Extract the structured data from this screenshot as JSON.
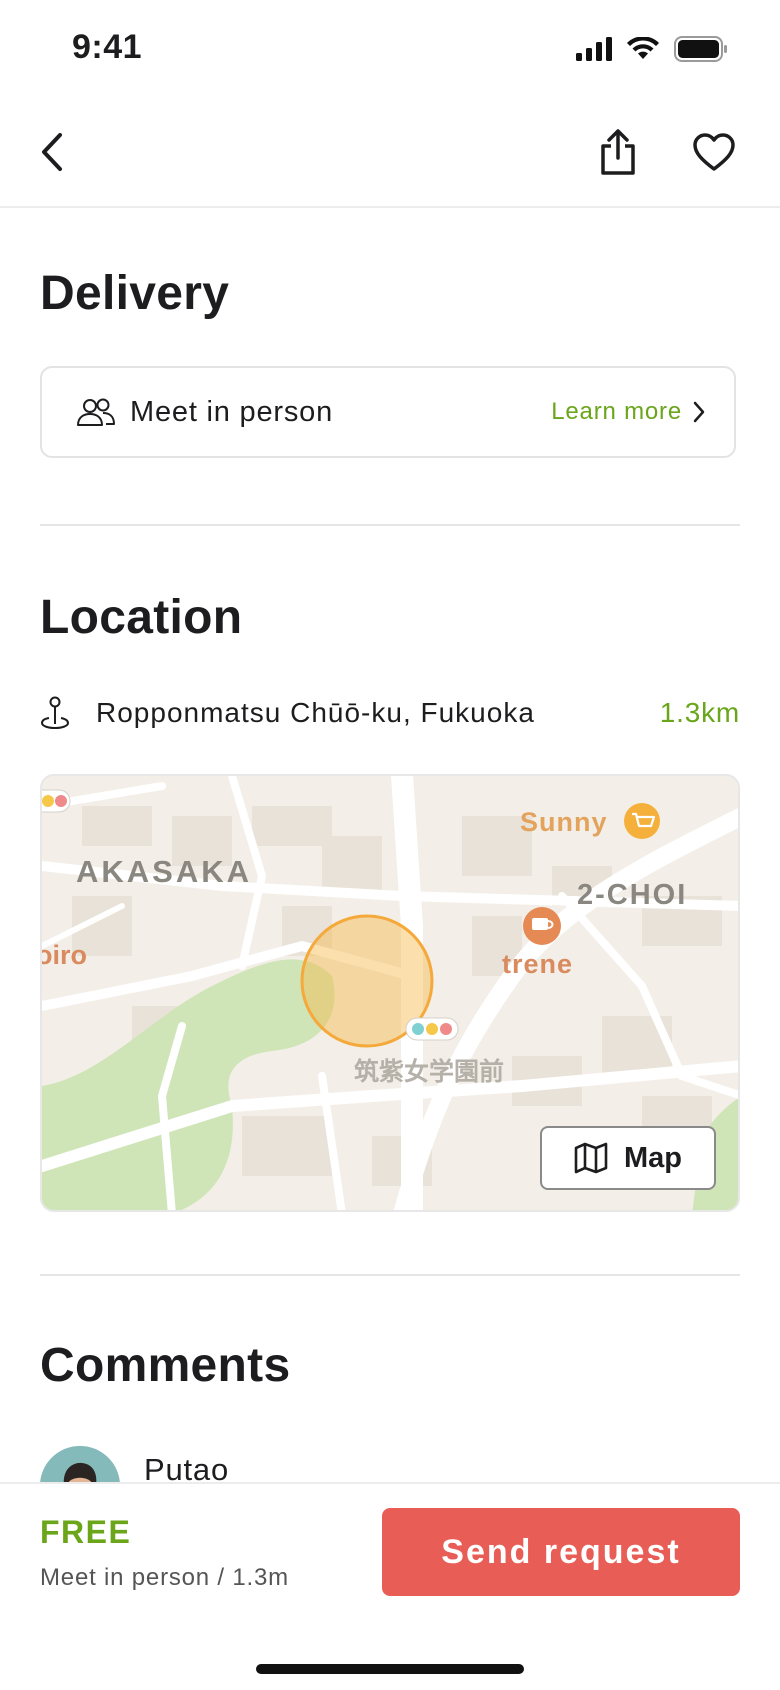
{
  "status_bar": {
    "time": "9:41"
  },
  "nav": {
    "back_icon": "chevron-left-icon",
    "share_icon": "share-icon",
    "favorite_icon": "heart-icon"
  },
  "delivery": {
    "title": "Delivery",
    "method_label": "Meet in person",
    "learn_more": "Learn more"
  },
  "location": {
    "title": "Location",
    "address": "Ropponmatsu Chūō-ku, Fukuoka",
    "distance": "1.3km",
    "map": {
      "labels": {
        "akasaka": "AKASAKA",
        "sunny": "Sunny",
        "chome": "2-CHOI",
        "trene": "trene",
        "hiro": "oiro",
        "station": "筑紫女学園前"
      },
      "map_button_label": "Map"
    }
  },
  "comments": {
    "title": "Comments",
    "items": [
      {
        "name": "Putao"
      }
    ]
  },
  "bottom_bar": {
    "price": "FREE",
    "subtitle": "Meet in person / 1.3m",
    "cta": "Send request"
  },
  "colors": {
    "accent_green": "#6aa51a",
    "cta_red": "#e85d55",
    "map_bg": "#f3efe8",
    "park_green": "#cfe5b8",
    "pin_orange": "#f7b74a"
  }
}
